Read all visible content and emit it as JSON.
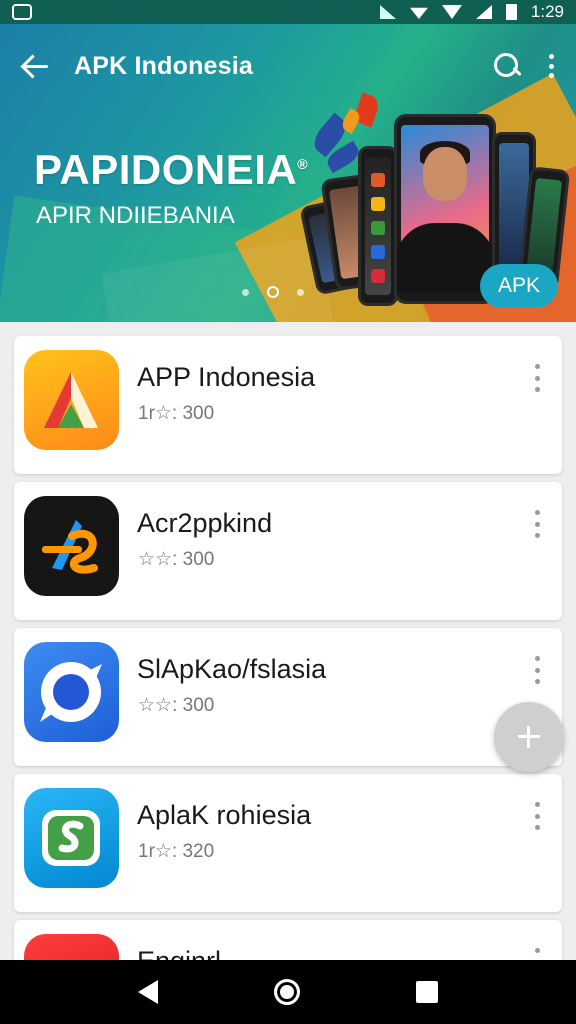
{
  "status_bar": {
    "time": "1:29"
  },
  "header": {
    "title": "APK Indonesia",
    "banner_title": "PAPIDONEIA",
    "banner_registered": "®",
    "banner_subtitle": "APIR NDIIEBANIA",
    "badge": "APK"
  },
  "apps": [
    {
      "name": "APP Indonesia",
      "meta": "1r☆: 300"
    },
    {
      "name": "Acr2ppkind",
      "meta": "☆☆: 300"
    },
    {
      "name": "SlApKao/fslasia",
      "meta": "☆☆: 300"
    },
    {
      "name": "AplaK rohiesia",
      "meta": "1r☆: 320"
    },
    {
      "name": "Enginrl",
      "meta": ""
    }
  ],
  "icons": {
    "back": "arrow-back-icon",
    "search": "search-icon",
    "overflow": "more-vert-icon",
    "fab": "add-icon"
  },
  "colors": {
    "status_bar": "#0f5f52",
    "accent": "#1ba6c4",
    "fab": "#cfcfcf"
  }
}
